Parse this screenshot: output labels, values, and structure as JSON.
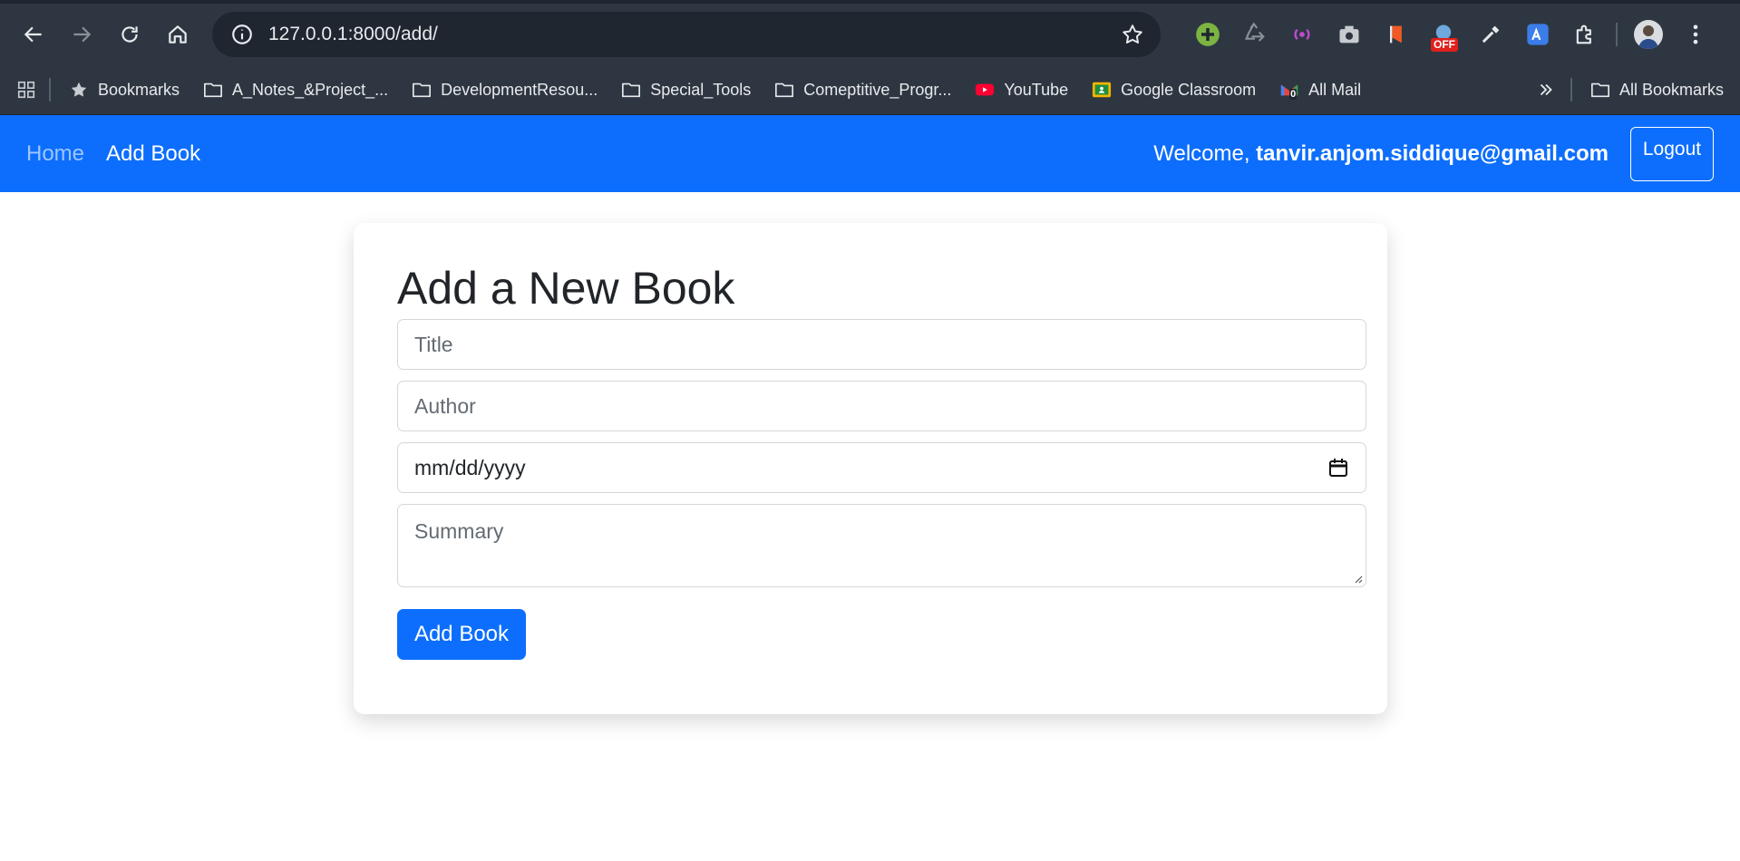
{
  "browser": {
    "url": "127.0.0.1:8000/add/",
    "bookmarks": [
      {
        "label": "Bookmarks",
        "icon": "star-icon"
      },
      {
        "label": "A_Notes_&Project_...",
        "icon": "folder-icon"
      },
      {
        "label": "DevelopmentResou...",
        "icon": "folder-icon"
      },
      {
        "label": "Special_Tools",
        "icon": "folder-icon"
      },
      {
        "label": "Comeptitive_Progr...",
        "icon": "folder-icon"
      },
      {
        "label": "YouTube",
        "icon": "youtube-icon"
      },
      {
        "label": "Google Classroom",
        "icon": "google-classroom-icon"
      },
      {
        "label": "All Mail",
        "icon": "gmail-icon"
      }
    ],
    "all_bookmarks_label": "All Bookmarks",
    "extension_off_badge": "OFF",
    "gmail_badge": "0"
  },
  "navbar": {
    "home_label": "Home",
    "add_book_label": "Add Book",
    "welcome_prefix": "Welcome, ",
    "user_email": "tanvir.anjom.siddique@gmail.com",
    "logout_label": "Logout",
    "colors": {
      "primary": "#0d6efd",
      "muted_link": "#9ec5fe"
    }
  },
  "form": {
    "heading": "Add a New Book",
    "title_placeholder": "Title",
    "author_placeholder": "Author",
    "date_placeholder": "mm/dd/yyyy",
    "summary_placeholder": "Summary",
    "submit_label": "Add Book"
  }
}
